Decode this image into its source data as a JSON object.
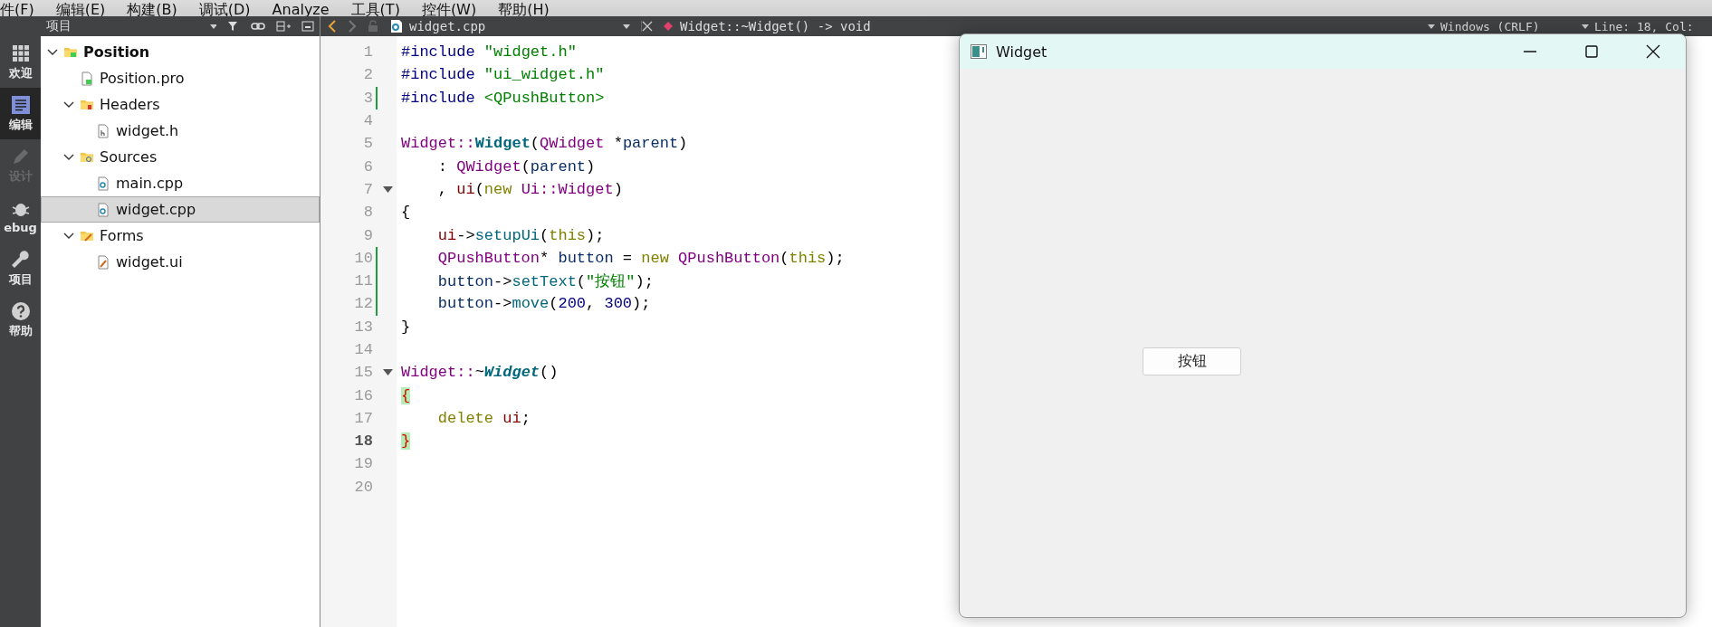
{
  "menu": [
    {
      "label": "件(F)"
    },
    {
      "label": "编辑(E)"
    },
    {
      "label": "构建(B)"
    },
    {
      "label": "调试(D)"
    },
    {
      "label": "Analyze"
    },
    {
      "label": "工具(T)"
    },
    {
      "label": "控件(W)"
    },
    {
      "label": "帮助(H)"
    }
  ],
  "modes": [
    {
      "label": "欢迎",
      "kind": "grid",
      "selected": false,
      "disabled": false
    },
    {
      "label": "编辑",
      "kind": "edit",
      "selected": true,
      "disabled": false
    },
    {
      "label": "设计",
      "kind": "pencil",
      "selected": false,
      "disabled": true
    },
    {
      "label": "ebug",
      "kind": "bug",
      "selected": false,
      "disabled": false
    },
    {
      "label": "项目",
      "kind": "wrench",
      "selected": false,
      "disabled": false
    },
    {
      "label": "帮助",
      "kind": "help",
      "selected": false,
      "disabled": false
    }
  ],
  "project_panel": {
    "title": "项目",
    "tree": [
      {
        "label": "Position",
        "kind": "project",
        "expanded": true,
        "selected": false,
        "children": [
          {
            "label": "Position.pro",
            "kind": "pro",
            "selected": false
          },
          {
            "label": "Headers",
            "kind": "folder-h",
            "expanded": true,
            "selected": false,
            "children": [
              {
                "label": "widget.h",
                "kind": "header",
                "selected": false
              }
            ]
          },
          {
            "label": "Sources",
            "kind": "folder-cpp",
            "expanded": true,
            "selected": false,
            "children": [
              {
                "label": "main.cpp",
                "kind": "source",
                "selected": false
              },
              {
                "label": "widget.cpp",
                "kind": "source",
                "selected": true
              }
            ]
          },
          {
            "label": "Forms",
            "kind": "folder-ui",
            "expanded": true,
            "selected": false,
            "children": [
              {
                "label": "widget.ui",
                "kind": "form",
                "selected": false
              }
            ]
          }
        ]
      }
    ]
  },
  "editor": {
    "file": "widget.cpp",
    "symbol": "Widget::~Widget() -> void",
    "line_ending": "Windows (CRLF)",
    "position": "Line: 18, Col:",
    "lines": [
      {
        "number": "1",
        "changed": false,
        "fold": false,
        "current": false,
        "tokens": [
          {
            "t": "#include",
            "kind": "preproc"
          },
          {
            "t": " \"widget.h\"",
            "kind": "string"
          }
        ]
      },
      {
        "number": "2",
        "changed": false,
        "fold": false,
        "current": false,
        "tokens": [
          {
            "t": "#include",
            "kind": "preproc"
          },
          {
            "t": " \"ui_widget.h\"",
            "kind": "string"
          }
        ]
      },
      {
        "number": "3",
        "changed": true,
        "fold": false,
        "current": false,
        "tokens": [
          {
            "t": "#include",
            "kind": "preproc"
          },
          {
            "t": " <QPushButton>",
            "kind": "string"
          }
        ]
      },
      {
        "number": "4",
        "changed": false,
        "fold": false,
        "current": false
      },
      {
        "number": "5",
        "changed": false,
        "fold": false,
        "current": false,
        "tokens": [
          {
            "t": "Widget::",
            "kind": "type"
          },
          {
            "t": "Widget",
            "kind": "func"
          },
          {
            "t": "(",
            "kind": "plain"
          },
          {
            "t": "QWidget",
            "kind": "type"
          },
          {
            "t": " *",
            "kind": "plain"
          },
          {
            "t": "parent",
            "kind": "var"
          },
          {
            "t": ")",
            "kind": "plain"
          }
        ]
      },
      {
        "number": "6",
        "changed": false,
        "fold": false,
        "current": false,
        "tokens": [
          {
            "t": "    : ",
            "kind": "plain"
          },
          {
            "t": "QWidget",
            "kind": "type"
          },
          {
            "t": "(",
            "kind": "plain"
          },
          {
            "t": "parent",
            "kind": "var"
          },
          {
            "t": ")",
            "kind": "plain"
          }
        ]
      },
      {
        "number": "7",
        "changed": false,
        "fold": true,
        "current": false,
        "tokens": [
          {
            "t": "    , ",
            "kind": "plain"
          },
          {
            "t": "ui",
            "kind": "member"
          },
          {
            "t": "(",
            "kind": "plain"
          },
          {
            "t": "new",
            "kind": "keyword"
          },
          {
            "t": " Ui::Widget",
            "kind": "type"
          },
          {
            "t": ")",
            "kind": "plain"
          }
        ]
      },
      {
        "number": "8",
        "changed": false,
        "fold": false,
        "current": false,
        "tokens": [
          {
            "t": "{",
            "kind": "plain"
          }
        ]
      },
      {
        "number": "9",
        "changed": false,
        "fold": false,
        "current": false,
        "tokens": [
          {
            "t": "    ui",
            "kind": "member"
          },
          {
            "t": "->",
            "kind": "plain"
          },
          {
            "t": "setupUi",
            "kind": "method"
          },
          {
            "t": "(",
            "kind": "plain"
          },
          {
            "t": "this",
            "kind": "keyword"
          },
          {
            "t": ");",
            "kind": "plain"
          }
        ]
      },
      {
        "number": "10",
        "changed": true,
        "fold": false,
        "current": false,
        "tokens": [
          {
            "t": "    QPushButton",
            "kind": "type"
          },
          {
            "t": "* ",
            "kind": "plain"
          },
          {
            "t": "button",
            "kind": "var"
          },
          {
            "t": " = ",
            "kind": "plain"
          },
          {
            "t": "new",
            "kind": "keyword"
          },
          {
            "t": " QPushButton",
            "kind": "type"
          },
          {
            "t": "(",
            "kind": "plain"
          },
          {
            "t": "this",
            "kind": "keyword"
          },
          {
            "t": ");",
            "kind": "plain"
          }
        ]
      },
      {
        "number": "11",
        "changed": true,
        "fold": false,
        "current": false,
        "tokens": [
          {
            "t": "    button",
            "kind": "var"
          },
          {
            "t": "->",
            "kind": "plain"
          },
          {
            "t": "setText",
            "kind": "method"
          },
          {
            "t": "(",
            "kind": "plain"
          },
          {
            "t": "\"按钮\"",
            "kind": "string"
          },
          {
            "t": ");",
            "kind": "plain"
          }
        ]
      },
      {
        "number": "12",
        "changed": true,
        "fold": false,
        "current": false,
        "tokens": [
          {
            "t": "    button",
            "kind": "var"
          },
          {
            "t": "->",
            "kind": "plain"
          },
          {
            "t": "move",
            "kind": "method"
          },
          {
            "t": "(",
            "kind": "plain"
          },
          {
            "t": "200",
            "kind": "number"
          },
          {
            "t": ", ",
            "kind": "plain"
          },
          {
            "t": "300",
            "kind": "number"
          },
          {
            "t": ");",
            "kind": "plain"
          }
        ]
      },
      {
        "number": "13",
        "changed": false,
        "fold": false,
        "current": false,
        "tokens": [
          {
            "t": "}",
            "kind": "plain"
          }
        ]
      },
      {
        "number": "14",
        "changed": false,
        "fold": false,
        "current": false
      },
      {
        "number": "15",
        "changed": false,
        "fold": true,
        "current": false,
        "tokens": [
          {
            "t": "Widget::",
            "kind": "type"
          },
          {
            "t": "~",
            "kind": "plain"
          },
          {
            "t": "Widget",
            "kind": "func-italic"
          },
          {
            "t": "()",
            "kind": "plain"
          }
        ]
      },
      {
        "number": "16",
        "changed": false,
        "fold": false,
        "current": false,
        "tokens": [
          {
            "t": "{",
            "kind": "match"
          }
        ]
      },
      {
        "number": "17",
        "changed": false,
        "fold": false,
        "current": false,
        "tokens": [
          {
            "t": "    delete",
            "kind": "keyword"
          },
          {
            "t": " ui",
            "kind": "member"
          },
          {
            "t": ";",
            "kind": "plain"
          }
        ]
      },
      {
        "number": "18",
        "changed": false,
        "fold": false,
        "current": true,
        "tokens": [
          {
            "t": "}",
            "kind": "match"
          }
        ]
      },
      {
        "number": "19",
        "changed": false,
        "fold": false,
        "current": false
      },
      {
        "number": "20",
        "changed": false,
        "fold": false,
        "current": false
      }
    ]
  },
  "widget_window": {
    "title": "Widget",
    "button": "按钮"
  }
}
